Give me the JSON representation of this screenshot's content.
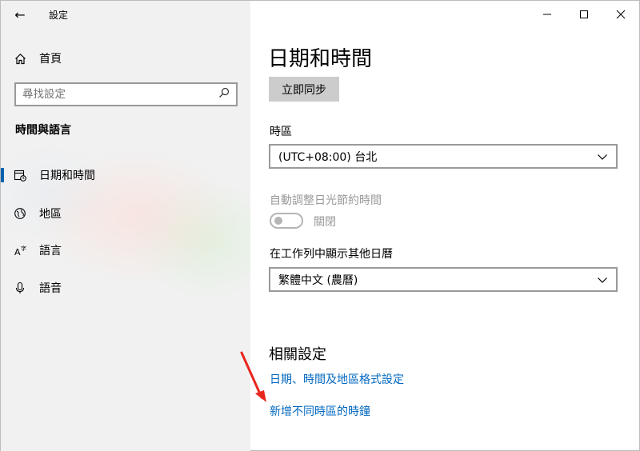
{
  "window": {
    "app_title": "設定",
    "back_icon": "back-arrow-icon",
    "controls": {
      "minimize": "minimize-icon",
      "maximize": "maximize-icon",
      "close": "close-icon"
    }
  },
  "sidebar": {
    "home_label": "首頁",
    "search_placeholder": "尋找設定",
    "section_heading": "時間與語言",
    "items": [
      {
        "label": "日期和時間",
        "icon": "calendar-clock-icon",
        "selected": true
      },
      {
        "label": "地區",
        "icon": "region-icon",
        "selected": false
      },
      {
        "label": "語言",
        "icon": "language-icon",
        "selected": false
      },
      {
        "label": "語音",
        "icon": "microphone-icon",
        "selected": false
      }
    ]
  },
  "main": {
    "page_title": "日期和時間",
    "sync_button_label": "立即同步",
    "timezone_label": "時區",
    "timezone_value": "(UTC+08:00) 台北",
    "dst_label": "自動調整日光節約時間",
    "dst_toggle_state": "關閉",
    "calendar_label": "在工作列中顯示其他日曆",
    "calendar_value": "繁體中文 (農曆)",
    "related_heading": "相關設定",
    "links": [
      "日期、時間及地區格式設定",
      "新增不同時區的時鐘"
    ]
  },
  "colors": {
    "accent": "#0063b1",
    "link": "#0067c0",
    "annotation_arrow": "#e8261e",
    "disabled_text": "#9a9a9a"
  }
}
